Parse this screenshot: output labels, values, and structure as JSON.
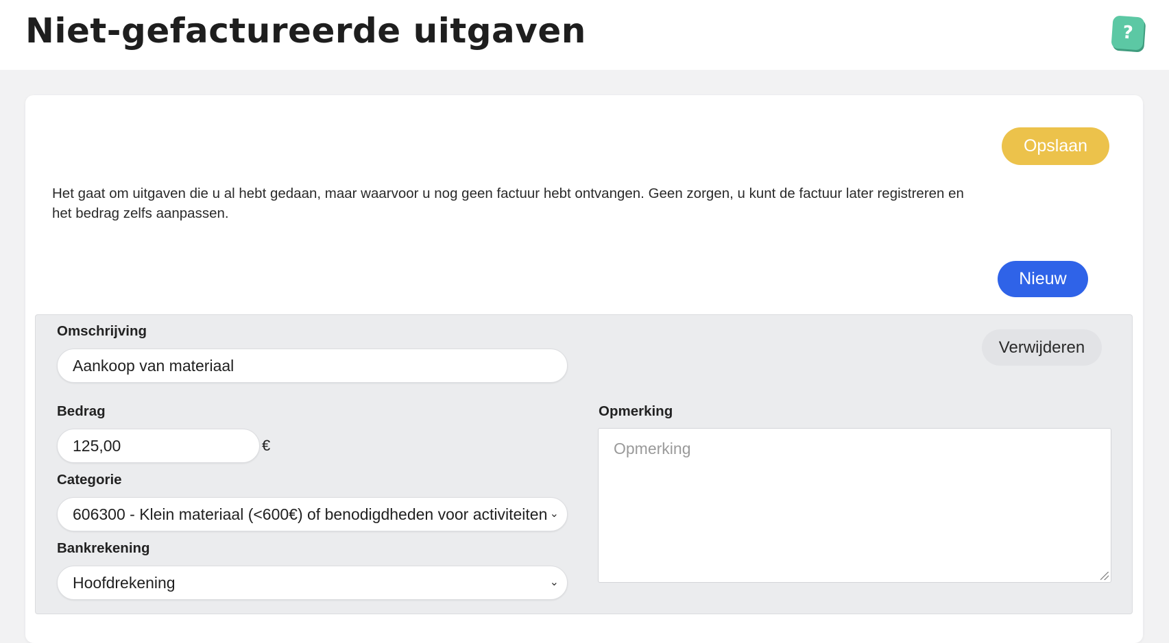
{
  "header": {
    "title": "Niet-gefactureerde uitgaven",
    "help_label": "?"
  },
  "actions": {
    "save_label": "Opslaan",
    "new_label": "Nieuw",
    "delete_label": "Verwijderen"
  },
  "intro_text": "Het gaat om uitgaven die u al hebt gedaan, maar waarvoor u nog geen factuur hebt ontvangen. Geen zorgen, u kunt de factuur later registreren en het bedrag zelfs aanpassen.",
  "expense": {
    "description_label": "Omschrijving",
    "description_value": "Aankoop van materiaal",
    "amount_label": "Bedrag",
    "amount_value": "125,00",
    "currency": "€",
    "category_label": "Categorie",
    "category_value": "606300 - Klein materiaal (<600€) of benodigdheden voor activiteiten",
    "bank_label": "Bankrekening",
    "bank_value": "Hoofdrekening",
    "remark_label": "Opmerking",
    "remark_placeholder": "Opmerking"
  },
  "colors": {
    "save_button": "#ecc24b",
    "new_button": "#2f63e8",
    "help_button": "#5cc8a4"
  }
}
